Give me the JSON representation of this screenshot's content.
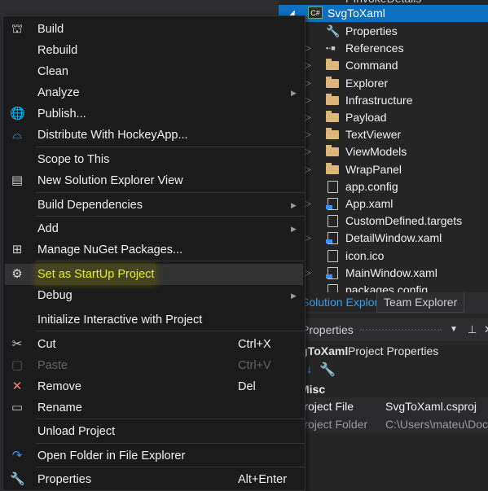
{
  "solution_explorer": {
    "clipped_top_item": "PInvokeDetails",
    "project": "SvgToXaml",
    "project_badge": "C#",
    "items": [
      {
        "label": "Properties",
        "icon": "wrench-icon",
        "expandable": false
      },
      {
        "label": "References",
        "icon": "references-icon",
        "expandable": true
      },
      {
        "label": "Command",
        "icon": "folder-icon",
        "expandable": true
      },
      {
        "label": "Explorer",
        "icon": "folder-icon",
        "expandable": true
      },
      {
        "label": "Infrastructure",
        "icon": "folder-icon",
        "expandable": true
      },
      {
        "label": "Payload",
        "icon": "folder-icon",
        "expandable": true
      },
      {
        "label": "TextViewer",
        "icon": "folder-icon",
        "expandable": true
      },
      {
        "label": "ViewModels",
        "icon": "folder-icon",
        "expandable": true
      },
      {
        "label": "WrapPanel",
        "icon": "folder-icon",
        "expandable": true
      },
      {
        "label": "app.config",
        "icon": "config-file-icon",
        "expandable": false
      },
      {
        "label": "App.xaml",
        "icon": "xaml-file-icon",
        "expandable": true
      },
      {
        "label": "CustomDefined.targets",
        "icon": "file-icon",
        "expandable": false
      },
      {
        "label": "DetailWindow.xaml",
        "icon": "xaml-file-icon",
        "expandable": true
      },
      {
        "label": "icon.ico",
        "icon": "ico-file-icon",
        "expandable": false
      },
      {
        "label": "MainWindow.xaml",
        "icon": "xaml-file-icon",
        "expandable": true
      },
      {
        "label": "packages.config",
        "icon": "config-file-icon",
        "expandable": false
      }
    ]
  },
  "tabs": {
    "solution_explorer": "Solution Explorer",
    "team_explorer": "Team Explorer"
  },
  "properties": {
    "title": "Properties",
    "subtitle_bold": "SvgToXaml",
    "subtitle": "Project Properties",
    "category": "Misc",
    "rows": [
      {
        "key": "Project File",
        "value": "SvgToXaml.csproj"
      },
      {
        "key": "Project Folder",
        "value": "C:\\Users\\mateu\\Documents"
      }
    ]
  },
  "menu": {
    "items": [
      {
        "label": "Build",
        "icon": "build-icon",
        "y": 0
      },
      {
        "label": "Rebuild",
        "y": 1
      },
      {
        "label": "Clean",
        "y": 2
      },
      {
        "label": "Analyze",
        "submenu": true,
        "y": 3
      },
      {
        "label": "Publish...",
        "icon": "publish-icon",
        "y": 4
      },
      {
        "label": "Distribute With HockeyApp...",
        "icon": "hockeyapp-icon",
        "y": 5
      },
      {
        "label": "Scope to This"
      },
      {
        "label": "New Solution Explorer View",
        "icon": "new-view-icon"
      },
      {
        "label": "Build Dependencies",
        "submenu": true
      },
      {
        "label": "Add",
        "submenu": true
      },
      {
        "label": "Manage NuGet Packages...",
        "icon": "nuget-icon"
      },
      {
        "label": "Set as StartUp Project",
        "icon": "gear-icon",
        "highlighted": true
      },
      {
        "label": "Debug",
        "submenu": true
      },
      {
        "label": "Initialize Interactive with Project"
      },
      {
        "label": "Cut",
        "icon": "scissors-icon",
        "shortcut": "Ctrl+X"
      },
      {
        "label": "Paste",
        "icon": "paste-icon",
        "shortcut": "Ctrl+V",
        "disabled": true
      },
      {
        "label": "Remove",
        "icon": "remove-icon",
        "shortcut": "Del"
      },
      {
        "label": "Rename",
        "icon": "rename-icon"
      },
      {
        "label": "Unload Project"
      },
      {
        "label": "Open Folder in File Explorer",
        "icon": "open-folder-icon"
      },
      {
        "label": "Properties",
        "icon": "wrench-icon",
        "shortcut": "Alt+Enter"
      }
    ]
  }
}
